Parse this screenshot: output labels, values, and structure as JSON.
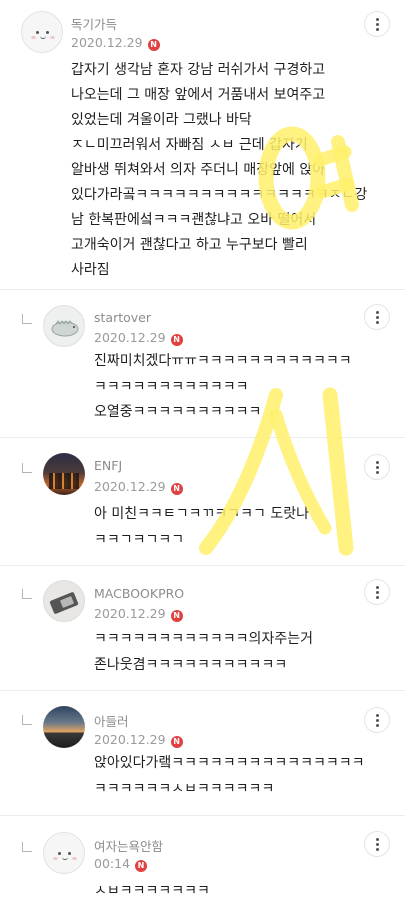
{
  "comments": [
    {
      "author": "독기가득",
      "date": "2020.12.29",
      "new_badge": "N",
      "avatar": "smiley-face-avatar",
      "text": "갑자기 생각남 혼자 강남 러쉬가서 구경하고\n나오는데 그 매장 앞에서 거품내서 보여주고\n있었는데 겨울이라 그랬나 바닥\nㅈㄴ미끄러워서 자빠짐 ㅅㅂ 근데 갑자기\n알바생 뛰쳐와서 의자 주더니 매장앞에 앉아\n있다가라곸ㅋㅋㅋㅋㅋㅋㅋㅋㅋㅋㅋㅋㅋㅋㅋㅈㄴ강\n남 한복판에섴ㅋㅋㅋ괜찮냐고 오바 떨어서\n고개숙이거 괜찮다고 하고 누구보다 빨리\n사라짐"
    },
    {
      "author": "startover",
      "date": "2020.12.29",
      "new_badge": "N",
      "avatar": "dinosaur-avatar",
      "text": "진짜미치겠다ㅠㅠㅋㅋㅋㅋㅋㅋㅋㅋㅋㅋㅋㅋ\nㅋㅋㅋㅋㅋㅋㅋㅋㅋㅋㅋㅋ\n오열중ㅋㅋㅋㅋㅋㅋㅋㅋㅋㅋ"
    },
    {
      "author": "ENFJ",
      "date": "2020.12.29",
      "new_badge": "N",
      "avatar": "city-night-avatar",
      "text": "아 미친ㅋㅋㅌㄱㅋㄲㅋㄱㅋㄱ 도랏나\nㅋㅋㄱㅋㄱㅋㄱ"
    },
    {
      "author": "MACBOOKPRO",
      "date": "2020.12.29",
      "new_badge": "N",
      "avatar": "laptop-avatar",
      "text": "ㅋㅋㅋㅋㅋㅋㅋㅋㅋㅋㅋㅋ의자주는거\n존나웃겸ㅋㅋㅋㅋㅋㅋㅋㅋㅋㅋㅋ"
    },
    {
      "author": "아들러",
      "date": "2020.12.29",
      "new_badge": "N",
      "avatar": "sunset-avatar",
      "text": "앉아있다가랰ㅋㅋㅋㅋㅋㅋㅋㅋㅋㅋㅋㅋㅋㅋㅋ\nㅋㅋㅋㅋㅋㅋㅅㅂㅋㅋㅋㅋㅋㅋ"
    },
    {
      "author": "여자는욕안함",
      "date": "00:14",
      "new_badge": "N",
      "avatar": "smiley-face-avatar",
      "text": "ㅅㅂㅋㅋㅋㅋㅋㅋㅋ"
    }
  ],
  "watermark": {
    "text": "여시",
    "color": "#fff06a"
  },
  "colors": {
    "new_badge": "#e0403f",
    "author": "#8c8c8c",
    "divider": "#ececec"
  }
}
